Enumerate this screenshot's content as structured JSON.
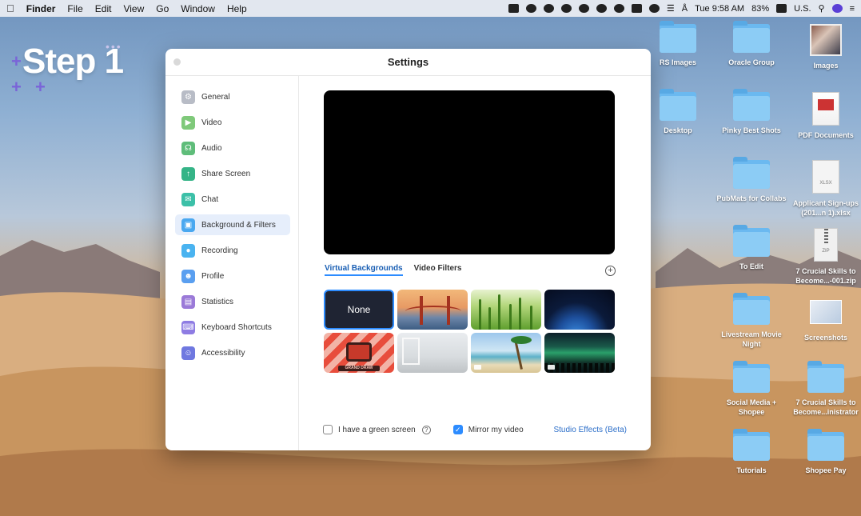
{
  "menubar": {
    "apple": "",
    "app": "Finder",
    "menus": [
      "File",
      "Edit",
      "View",
      "Go",
      "Window",
      "Help"
    ],
    "clock": "Tue 9:58 AM",
    "battery": "83%",
    "input_source": "U.S."
  },
  "overlay": {
    "step_label": "Step 1"
  },
  "window": {
    "title": "Settings",
    "sidebar": [
      {
        "label": "General",
        "icon": "gear-icon",
        "color": "#b8bcc6"
      },
      {
        "label": "Video",
        "icon": "video-icon",
        "color": "#7fc97a"
      },
      {
        "label": "Audio",
        "icon": "headphones-icon",
        "color": "#5fbd7a"
      },
      {
        "label": "Share Screen",
        "icon": "share-screen-icon",
        "color": "#35b487"
      },
      {
        "label": "Chat",
        "icon": "chat-icon",
        "color": "#3cc0a8"
      },
      {
        "label": "Background & Filters",
        "icon": "background-icon",
        "color": "#4aa8f0"
      },
      {
        "label": "Recording",
        "icon": "record-icon",
        "color": "#4ab3f0"
      },
      {
        "label": "Profile",
        "icon": "profile-icon",
        "color": "#5a9ff0"
      },
      {
        "label": "Statistics",
        "icon": "statistics-icon",
        "color": "#9b7ad8"
      },
      {
        "label": "Keyboard Shortcuts",
        "icon": "keyboard-icon",
        "color": "#8e7ce3"
      },
      {
        "label": "Accessibility",
        "icon": "accessibility-icon",
        "color": "#6f78e0"
      }
    ],
    "active_item": "Background & Filters",
    "tabs": [
      "Virtual Backgrounds",
      "Video Filters"
    ],
    "none_label": "None",
    "green_screen_label": "I have a green screen",
    "green_screen_checked": false,
    "mirror_label": "Mirror my video",
    "mirror_checked": true,
    "studio_effects_label": "Studio Effects (Beta)",
    "tv_caption": "GRAND DRAW"
  },
  "desktop": {
    "icons": [
      {
        "label": "RS Images",
        "type": "folder"
      },
      {
        "label": "Oracle Group",
        "type": "folder"
      },
      {
        "label": "Images",
        "type": "photo"
      },
      {
        "label": "Desktop",
        "type": "folder"
      },
      {
        "label": "Pinky Best Shots",
        "type": "folder"
      },
      {
        "label": "PDF Documents",
        "type": "pdf"
      },
      {
        "label": "PubMats for Collabs",
        "type": "folder"
      },
      {
        "label": "Applicant Sign-ups (201...n 1).xlsx",
        "type": "xlsx",
        "tag": "XLSX"
      },
      {
        "label": "To Edit",
        "type": "folder"
      },
      {
        "label": "7 Crucial Skills to Become...-001.zip",
        "type": "zip",
        "tag": "ZIP"
      },
      {
        "label": "Livestream Movie Night",
        "type": "folder"
      },
      {
        "label": "Screenshots",
        "type": "screenshots"
      },
      {
        "label": "Social Media + Shopee",
        "type": "folder"
      },
      {
        "label": "7 Crucial Skills to Become...inistrator",
        "type": "folder"
      },
      {
        "label": "Tutorials",
        "type": "folder"
      },
      {
        "label": "Shopee Pay",
        "type": "folder"
      }
    ]
  }
}
